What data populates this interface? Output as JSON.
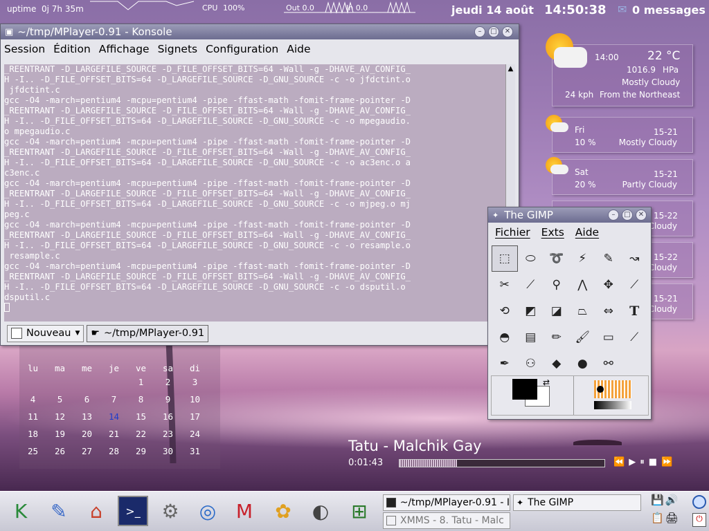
{
  "topbar": {
    "uptime_label": "uptime",
    "uptime_value": "0j 7h 35m",
    "cpu_label": "CPU",
    "cpu_value": "100%",
    "net_out_label": "Out 0.0",
    "net_in_label": "In 0.0",
    "date": "jeudi 14 août",
    "time": "14:50:38",
    "messages": "0 messages"
  },
  "konsole": {
    "title": "~/tmp/MPlayer-0.91 - Konsole",
    "menu": [
      "Session",
      "Édition",
      "Affichage",
      "Signets",
      "Configuration",
      "Aide"
    ],
    "lines": [
      "_REENTRANT -D_LARGEFILE_SOURCE -D_FILE_OFFSET_BITS=64 -Wall -g -DHAVE_AV_CONFIG_",
      "H -I.. -D_FILE_OFFSET_BITS=64 -D_LARGEFILE_SOURCE -D_GNU_SOURCE -c -o jfdctint.o",
      " jfdctint.c",
      "gcc -O4 -march=pentium4 -mcpu=pentium4 -pipe -ffast-math -fomit-frame-pointer -D",
      "_REENTRANT -D_LARGEFILE_SOURCE -D_FILE_OFFSET_BITS=64 -Wall -g -DHAVE_AV_CONFIG_",
      "H -I.. -D_FILE_OFFSET_BITS=64 -D_LARGEFILE_SOURCE -D_GNU_SOURCE -c -o mpegaudio.",
      "o mpegaudio.c",
      "gcc -O4 -march=pentium4 -mcpu=pentium4 -pipe -ffast-math -fomit-frame-pointer -D",
      "_REENTRANT -D_LARGEFILE_SOURCE -D_FILE_OFFSET_BITS=64 -Wall -g -DHAVE_AV_CONFIG_",
      "H -I.. -D_FILE_OFFSET_BITS=64 -D_LARGEFILE_SOURCE -D_GNU_SOURCE -c -o ac3enc.o a",
      "c3enc.c",
      "gcc -O4 -march=pentium4 -mcpu=pentium4 -pipe -ffast-math -fomit-frame-pointer -D",
      "_REENTRANT -D_LARGEFILE_SOURCE -D_FILE_OFFSET_BITS=64 -Wall -g -DHAVE_AV_CONFIG_",
      "H -I.. -D_FILE_OFFSET_BITS=64 -D_LARGEFILE_SOURCE -D_GNU_SOURCE -c -o mjpeg.o mj",
      "peg.c",
      "gcc -O4 -march=pentium4 -mcpu=pentium4 -pipe -ffast-math -fomit-frame-pointer -D",
      "_REENTRANT -D_LARGEFILE_SOURCE -D_FILE_OFFSET_BITS=64 -Wall -g -DHAVE_AV_CONFIG_",
      "H -I.. -D_FILE_OFFSET_BITS=64 -D_LARGEFILE_SOURCE -D_GNU_SOURCE -c -o resample.o",
      " resample.c",
      "gcc -O4 -march=pentium4 -mcpu=pentium4 -pipe -ffast-math -fomit-frame-pointer -D",
      "_REENTRANT -D_LARGEFILE_SOURCE -D_FILE_OFFSET_BITS=64 -Wall -g -DHAVE_AV_CONFIG_",
      "H -I.. -D_FILE_OFFSET_BITS=64 -D_LARGEFILE_SOURCE -D_GNU_SOURCE -c -o dsputil.o",
      "dsputil.c"
    ],
    "tab_new": "Nouveau",
    "tab_session": "~/tmp/MPlayer-0.91"
  },
  "calendar": {
    "days": [
      "lu",
      "ma",
      "me",
      "je",
      "ve",
      "sa",
      "di"
    ],
    "weeks": [
      [
        "",
        "",
        "",
        "",
        "1",
        "2",
        "3"
      ],
      [
        "4",
        "5",
        "6",
        "7",
        "8",
        "9",
        "10"
      ],
      [
        "11",
        "12",
        "13",
        "14",
        "15",
        "16",
        "17"
      ],
      [
        "18",
        "19",
        "20",
        "21",
        "22",
        "23",
        "24"
      ],
      [
        "25",
        "26",
        "27",
        "28",
        "29",
        "30",
        "31"
      ]
    ],
    "today_color": "#1e3ccc"
  },
  "weather": {
    "current": {
      "time": "14:00",
      "temp": "22 °C",
      "pressure": "1016.9",
      "pressure_unit": "HPa",
      "condition": "Mostly Cloudy",
      "wind_speed": "24 kph",
      "wind_dir": "From the Northeast"
    },
    "forecast": [
      {
        "day": "Fri",
        "range": "15-21",
        "precip": "10 %",
        "condition": "Mostly Cloudy"
      },
      {
        "day": "Sat",
        "range": "15-21",
        "precip": "20 %",
        "condition": "Partly Cloudy"
      },
      {
        "range": "15-22",
        "condition": "Cloudy"
      },
      {
        "range": "15-22",
        "condition": "Cloudy"
      },
      {
        "range": "15-21",
        "condition": "Cloudy"
      }
    ]
  },
  "gimp": {
    "title": "The GIMP",
    "menu": [
      "Fichier",
      "Exts",
      "Aide"
    ],
    "tools": [
      "rect-select",
      "ellipse-select",
      "free-select",
      "fuzzy-select",
      "bezier-select",
      "intelligent-scissors",
      "iscissors",
      "color-picker",
      "magnify",
      "measure",
      "move",
      "crop",
      "transform",
      "flip",
      "perspective",
      "shear",
      "flip-horizontal",
      "text",
      "bucket-fill",
      "blend",
      "pencil",
      "paintbrush",
      "eraser",
      "airbrush",
      "ink",
      "clone",
      "convolve",
      "smudge",
      "dodge-burn"
    ],
    "text_tool_glyph": "T",
    "fg_color": "#000000",
    "bg_color": "#ffffff"
  },
  "xmms": {
    "song": "Tatu - Malchik Gay",
    "time": "0:01:43",
    "progress": 0.28,
    "controls": [
      "⏪",
      "▶",
      "⏸",
      "■",
      "⏩"
    ]
  },
  "taskbar": {
    "launchers": [
      {
        "name": "kmenu",
        "glyph": "K"
      },
      {
        "name": "kedit",
        "glyph": "✎"
      },
      {
        "name": "home",
        "glyph": "⌂"
      },
      {
        "name": "terminal",
        "glyph": ">_"
      },
      {
        "name": "kcontrol",
        "glyph": "⚙"
      },
      {
        "name": "konqueror",
        "glyph": "◎"
      },
      {
        "name": "mozilla",
        "glyph": "M"
      },
      {
        "name": "gimp",
        "glyph": "✿"
      },
      {
        "name": "xmms",
        "glyph": "◐"
      },
      {
        "name": "windows",
        "glyph": "⊞"
      }
    ],
    "tasks": [
      {
        "label": "~/tmp/MPlayer-0.91 - I"
      },
      {
        "label": "The GIMP"
      },
      {
        "label": "XMMS - 8. Tatu - Malc"
      }
    ]
  }
}
